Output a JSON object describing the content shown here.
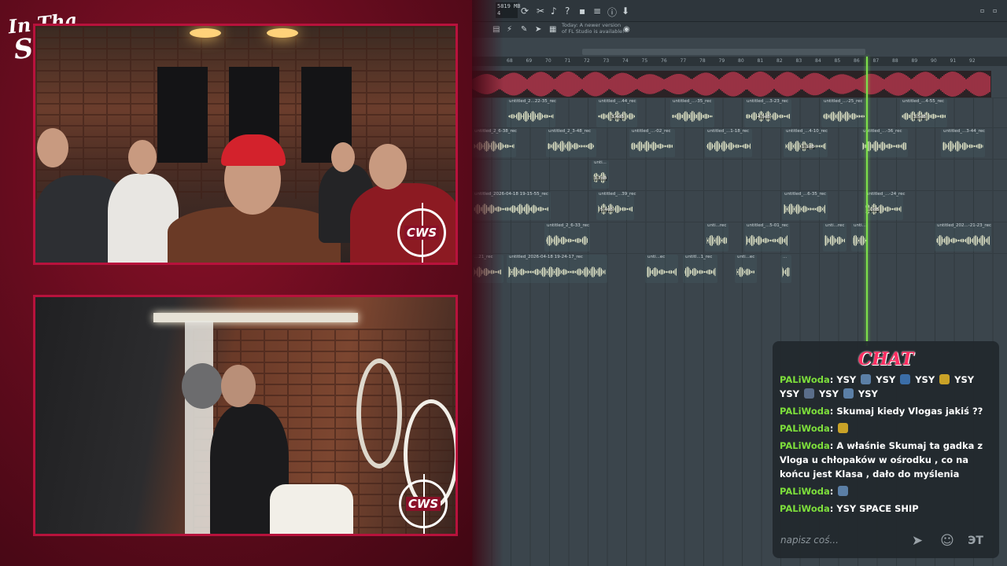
{
  "overlay": {
    "logo_line1": "In Tha",
    "logo_line2": "Studio!",
    "badge_text": "CWS"
  },
  "daw": {
    "cpu_readout": "5819 MB\n4",
    "update_notice": "Today: A newer version of FL Studio is available!",
    "ruler_ticks": [
      "68",
      "69",
      "70",
      "71",
      "72",
      "73",
      "74",
      "75",
      "76",
      "77",
      "78",
      "79",
      "80",
      "81",
      "82",
      "83",
      "84",
      "85",
      "86",
      "87",
      "88",
      "89",
      "90",
      "91",
      "92"
    ],
    "clips": [
      {
        "label": "untitled_2...22-35_rec"
      },
      {
        "label": "untitled_...44_rec"
      },
      {
        "label": "untitled_...-35_rec"
      },
      {
        "label": "untitled_...3-23_rec"
      },
      {
        "label": "untitled_...-25_rec"
      },
      {
        "label": "untitled_...4-55_rec"
      },
      {
        "label": "untitled_2_6-38_rec"
      },
      {
        "label": "untitled_2_3-48_rec"
      },
      {
        "label": "untitled_...-02_rec"
      },
      {
        "label": "untitled_...1-18_rec"
      },
      {
        "label": "untitled_...4-10_rec"
      },
      {
        "label": "untitled_...-36_rec"
      },
      {
        "label": "untitled_...3-44_rec"
      },
      {
        "label": "unti..."
      },
      {
        "label": "untitled_2026-04-18 19-15-55_rec"
      },
      {
        "label": "untitled_...39_rec"
      },
      {
        "label": "untitled_...6-35_rec"
      },
      {
        "label": "untitled_...-24_rec"
      },
      {
        "label": "untitled_2_6-33_rec"
      },
      {
        "label": "unti...rec"
      },
      {
        "label": "untitled_...5-01_rec"
      },
      {
        "label": "unti...rec"
      },
      {
        "label": "unti..."
      },
      {
        "label": "untitled_202...-21-23_rec"
      },
      {
        "label": "...21_rec"
      },
      {
        "label": "untitled_2026-04-18 19-24-17_rec"
      },
      {
        "label": "unti...ec"
      },
      {
        "label": "untitl...1_rec"
      },
      {
        "label": "unti...ec"
      },
      {
        "label": "..."
      }
    ],
    "gain_labels": [
      "4.5dB",
      "3.5dB",
      "1.1dB",
      "3.7dB",
      "5.4dB",
      "1.0dB",
      "3.4dB"
    ]
  },
  "chat": {
    "title": "CHAT",
    "messages": [
      {
        "user": "PALiWoda",
        "text": ": YSY {e} YSY {e} YSY {e} YSY YSY {e} YSY {e} YSY"
      },
      {
        "user": "PALiWoda",
        "text": ": Skumaj kiedy Vlogas jakiś ??"
      },
      {
        "user": "PALiWoda",
        "text": ": {e}"
      },
      {
        "user": "PALiWoda",
        "text": ": A właśnie Skumaj ta gadka z Vloga u chłopaków w ośrodku , co na końcu jest Klasa , dało do myślenia"
      },
      {
        "user": "PALiWoda",
        "text": ": {e}"
      },
      {
        "user": "PALiWoda",
        "text": ": YSY SPACE SHIP"
      }
    ],
    "input_placeholder": "napisz coś...",
    "send_icon": "send-icon",
    "emoji_icon": "emoji-icon",
    "extra_label": "ЭT"
  },
  "colors": {
    "accent_red": "#b8123c",
    "chat_user": "#7dde3b",
    "playhead": "#7de04a",
    "wave": "#d8dcc0",
    "master_wave": "#c83a52"
  }
}
